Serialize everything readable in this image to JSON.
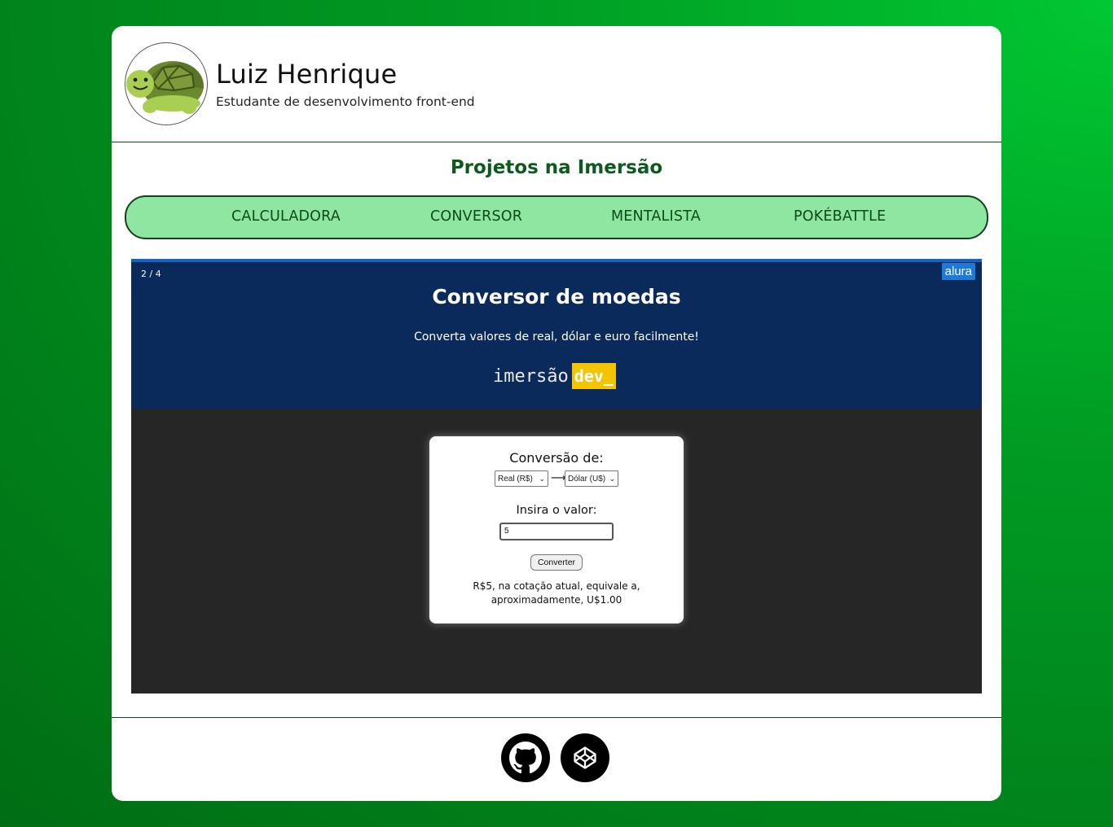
{
  "profile": {
    "name": "Luiz Henrique",
    "role": "Estudante de desenvolvimento front-end",
    "avatar_icon": "turtle-icon"
  },
  "section": {
    "title": "Projetos na Imersão"
  },
  "tabs": [
    {
      "label": "CALCULADORA"
    },
    {
      "label": "CONVERSOR"
    },
    {
      "label": "MENTALISTA"
    },
    {
      "label": "POKÉBATTLE"
    }
  ],
  "slide": {
    "counter": "2 / 4",
    "badge": "alura",
    "title": "Conversor de moedas",
    "subtitle": "Converta valores de real, dólar e euro facilmente!",
    "brand_a": "imersão",
    "brand_b": "dev_",
    "converter": {
      "label_from": "Conversão de:",
      "from_value": "Real (R$)",
      "to_value": "Dólar (U$)",
      "label_value": "Insira o valor:",
      "input_value": "5",
      "button_label": "Converter",
      "result_line1": "R$5, na cotação atual, equivale a,",
      "result_line2": "aproximadamente, U$1.00"
    }
  },
  "footer": {
    "icons": [
      "github-icon",
      "codepen-icon"
    ]
  },
  "colors": {
    "accent": "#0c5a1e",
    "tab_bg": "#8fe6a0",
    "slide_header": "#0b2a5c",
    "brand_yellow": "#f5c400"
  }
}
